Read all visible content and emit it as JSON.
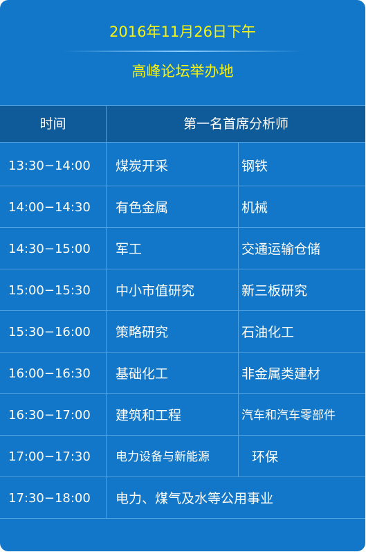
{
  "header": {
    "date": "2016年11月26日下午",
    "venue": "高峰论坛举办地"
  },
  "table": {
    "headers": {
      "time": "时间",
      "analyst": "第一名首席分析师"
    },
    "rows": [
      {
        "time": "13:30−14:00",
        "first": "煤炭开采",
        "second": "钢铁"
      },
      {
        "time": "14:00−14:30",
        "first": "有色金属",
        "second": "机械"
      },
      {
        "time": "14:30−15:00",
        "first": "军工",
        "second": "交通运输仓储"
      },
      {
        "time": "15:00−15:30",
        "first": "中小市值研究",
        "second": "新三板研究"
      },
      {
        "time": "15:30−16:00",
        "first": "策略研究",
        "second": "石油化工"
      },
      {
        "time": "16:00−16:30",
        "first": "基础化工",
        "second": "非金属类建材"
      },
      {
        "time": "16:30−17:00",
        "first": "建筑和工程",
        "second": "汽车和汽车零部件"
      },
      {
        "time": "17:00−17:30",
        "first": "电力设备与新能源",
        "second": "环保"
      },
      {
        "time": "17:30−18:00",
        "merged": "电力、煤气及水等公用事业"
      }
    ]
  },
  "colors": {
    "background": "#1277c9",
    "header_band": "#0f5a98",
    "accent_text": "#f6f10f",
    "grid_line": "#4fa0e0"
  }
}
